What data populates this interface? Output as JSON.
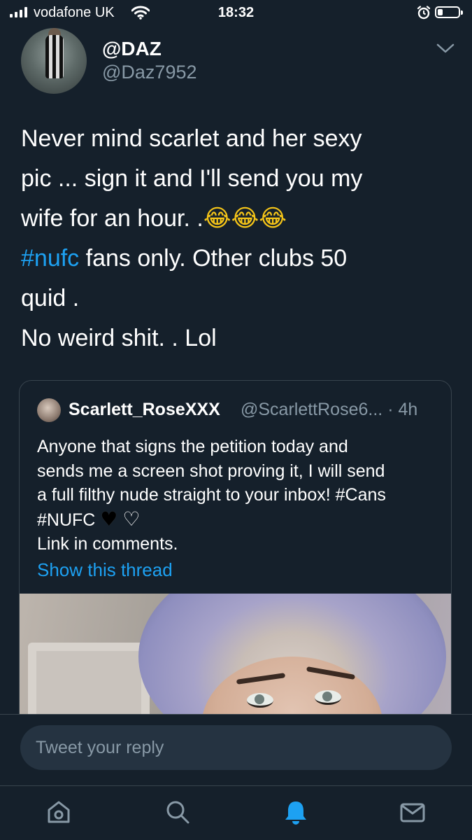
{
  "status_bar": {
    "carrier": "vodafone UK",
    "time": "18:32"
  },
  "tweet": {
    "display_name": "@DAZ",
    "handle": "@Daz7952",
    "text_lines": {
      "l1": "Never mind scarlet and her sexy",
      "l2": "pic ...   sign it and I'll send you my",
      "l3": "wife for an hour.  .",
      "l3_emoji": "😂😂😂",
      "l4_hashtag": "#nufc",
      "l4_rest": "  fans only.   Other clubs 50",
      "l5": "quid .",
      "l6": "No weird shit. . Lol"
    }
  },
  "quoted_tweet": {
    "display_name": "Scarlett_RoseXXX",
    "handle": "@ScarlettRose6...",
    "time": " · 4h",
    "text_lines": {
      "l1": "Anyone that signs the petition today and",
      "l2": "sends me a screen shot proving it, I will send",
      "l3": "a full filthy nude straight to your inbox! #Cans",
      "l4": "#NUFC ",
      "l4_hearts_black": "♥",
      "l4_hearts_white": "♡",
      "l5": "Link in comments."
    },
    "show_thread": "Show this thread"
  },
  "reply": {
    "placeholder": "Tweet your reply"
  },
  "nav": {
    "active": "notifications",
    "accent": "#1da1f2"
  },
  "colors": {
    "background": "#15202b",
    "text": "#ffffff",
    "secondary": "#8899a6",
    "link": "#1da1f2"
  }
}
